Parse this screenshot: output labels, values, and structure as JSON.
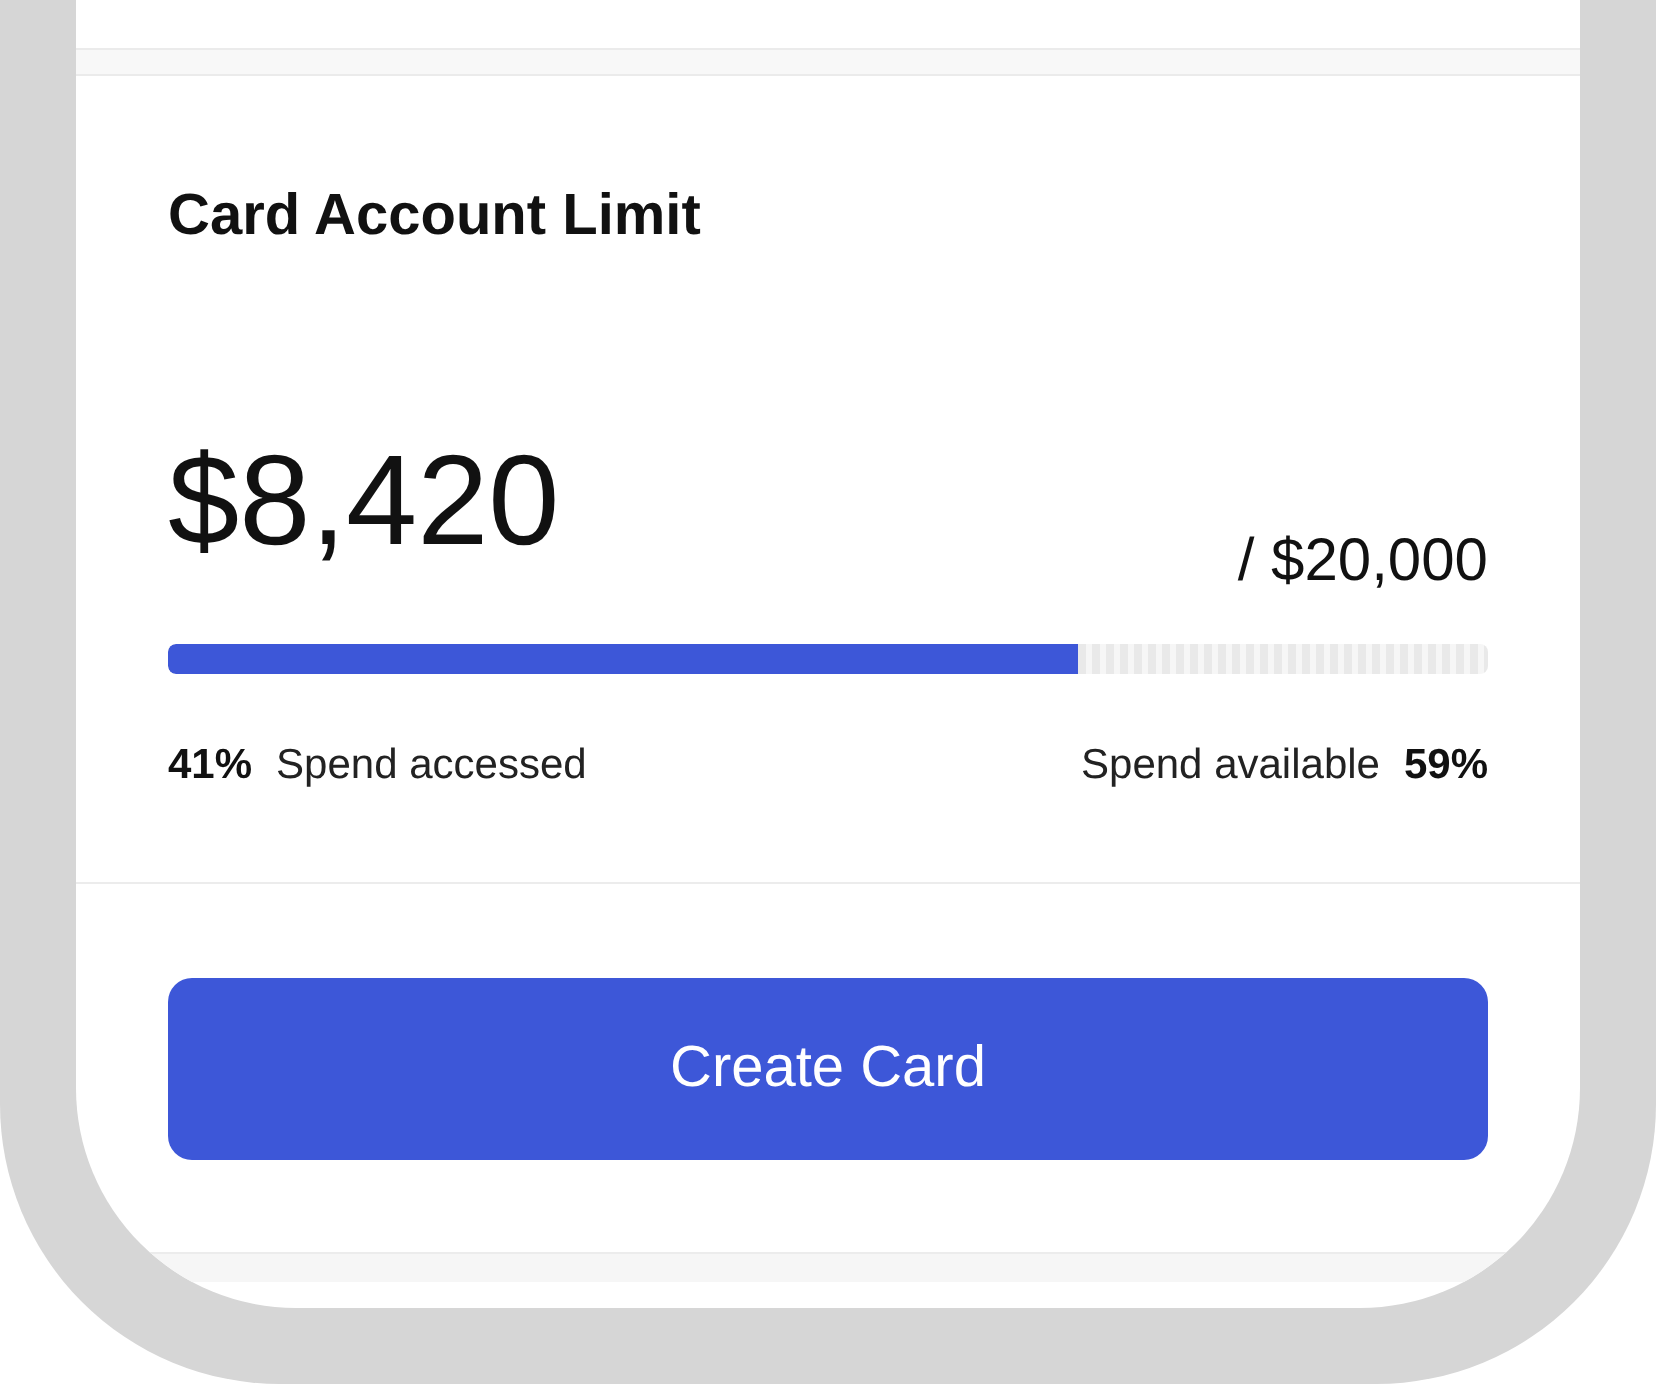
{
  "card": {
    "title": "Card Account Limit",
    "spent": "$8,420",
    "limit": "/ $20,000",
    "progress": {
      "level": 0.69
    },
    "accessed": {
      "percent": "41%",
      "label": "Spend accessed"
    },
    "available": {
      "label": "Spend available",
      "percent": "59%"
    }
  },
  "button": {
    "label": "Create Card"
  }
}
